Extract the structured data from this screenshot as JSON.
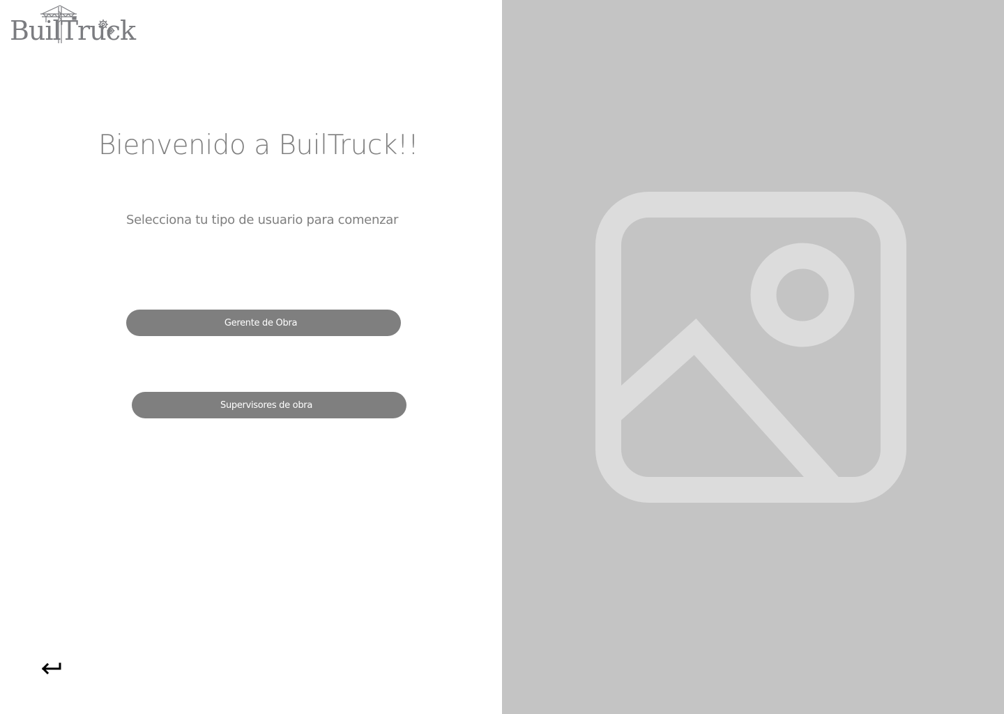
{
  "logo": {
    "text": "BuilTruck",
    "icon": "crane-icon"
  },
  "welcome": {
    "title": "Bienvenido a BuilTruck!!",
    "subtitle": "Selecciona tu tipo de usuario para comenzar"
  },
  "roles": {
    "manager_label": "Gerente de Obra",
    "supervisors_label": "Supervisores de obra"
  },
  "navigation": {
    "back_icon": "return-arrow-icon"
  },
  "hero": {
    "icon": "image-placeholder-icon"
  },
  "colors": {
    "text_gray": "#7f7f7f",
    "button_gray": "#7f7f7f",
    "panel_gray": "#c4c4c4",
    "placeholder_light": "#dcdcdc"
  }
}
